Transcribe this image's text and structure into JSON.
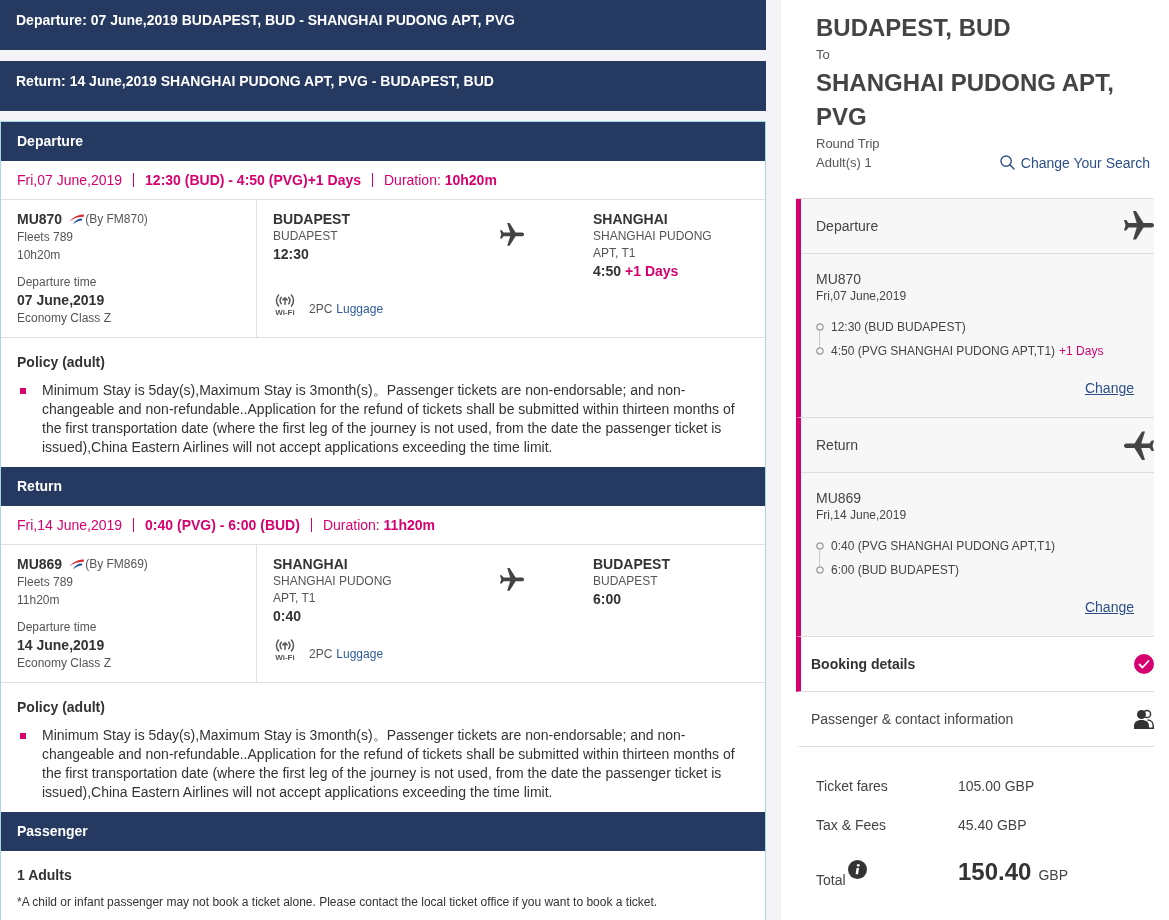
{
  "banners": [
    {
      "text": "Departure: 07 June,2019 BUDAPEST, BUD - SHANGHAI PUDONG APT, PVG"
    },
    {
      "text": "Return: 14 June,2019 SHANGHAI PUDONG APT, PVG - BUDAPEST, BUD"
    }
  ],
  "segments": [
    {
      "heading": "Departure",
      "date": "Fri,07 June,2019",
      "times": "12:30 (BUD) - 4:50 (PVG)+1 Days",
      "duration": "Duration: **10h20m**",
      "flight": {
        "number": "MU870",
        "operator": "(By FM870)",
        "fleet": "Fleets 789",
        "flight_time": "10h20m",
        "departure_label": "Departure time",
        "departure_date": "07 June,2019",
        "cabin": "Economy Class Z"
      },
      "origin": {
        "city": "BUDAPEST",
        "airport": "BUDAPEST",
        "time": "12:30"
      },
      "destination": {
        "city": "SHANGHAI",
        "airport": "SHANGHAI PUDONG APT, T1",
        "time": "4:50",
        "day_offset": "+1 Days"
      },
      "wifi_label": "Wi-Fi",
      "baggage": "2PC",
      "baggage_link": "Luggage",
      "policy": {
        "title": "Policy (adult)",
        "items": [
          "Minimum Stay is 5day(s),Maximum Stay is 3month(s)。Passenger tickets are non-endorsable; and non-changeable and non-refundable..Application for the refund of tickets shall be submitted within thirteen months of the first transportation date (where the first leg of the journey is not used, from the date the passenger ticket is issued),China Eastern Airlines will not accept applications exceeding the time limit."
        ]
      }
    },
    {
      "heading": "Return",
      "date": "Fri,14 June,2019",
      "times": "0:40 (PVG) - 6:00 (BUD)",
      "duration": "Duration: **11h20m**",
      "flight": {
        "number": "MU869",
        "operator": "(By FM869)",
        "fleet": "Fleets 789",
        "flight_time": "11h20m",
        "departure_label": "Departure time",
        "departure_date": "14 June,2019",
        "cabin": "Economy Class Z"
      },
      "origin": {
        "city": "SHANGHAI",
        "airport": "SHANGHAI PUDONG APT, T1",
        "time": "0:40"
      },
      "destination": {
        "city": "BUDAPEST",
        "airport": "BUDAPEST",
        "time": "6:00"
      },
      "wifi_label": "Wi-Fi",
      "baggage": "2PC",
      "baggage_link": "Luggage",
      "policy": {
        "title": "Policy (adult)",
        "items": [
          "Minimum Stay is 5day(s),Maximum Stay is 3month(s)。Passenger tickets are non-endorsable; and non-changeable and non-refundable..Application for the refund of tickets shall be submitted within thirteen months of the first transportation date (where the first leg of the journey is not used, from the date the passenger ticket is issued),China Eastern Airlines will not accept applications exceeding the time limit."
        ]
      }
    }
  ],
  "passenger": {
    "heading": "Passenger",
    "count": "1 Adults",
    "note": "*A child or infant passenger may not book a ticket alone. Please contact the local ticket office if you want to book a ticket."
  },
  "summary": {
    "origin": "BUDAPEST, BUD",
    "connector": "To",
    "destination": "SHANGHAI PUDONG APT, PVG",
    "trip_type": "Round Trip",
    "travellers": "Adult(s) 1",
    "change_search": "Change Your Search",
    "steps": [
      {
        "kind": "outbound",
        "title": "Departure",
        "active": true,
        "flight": "MU870",
        "date": "Fri,07 June,2019",
        "stops": [
          {
            "text": "12:30 (BUD BUDAPEST)"
          },
          {
            "text": "4:50 (PVG SHANGHAI PUDONG APT,T1)",
            "day_offset": "+1 Days"
          }
        ],
        "change": "Change"
      },
      {
        "kind": "inbound",
        "title": "Return",
        "active": true,
        "flight": "MU869",
        "date": "Fri,14 June,2019",
        "stops": [
          {
            "text": "0:40 (PVG SHANGHAI PUDONG APT,T1)"
          },
          {
            "text": "6:00 (BUD BUDAPEST)"
          }
        ],
        "change": "Change"
      },
      {
        "kind": "completed",
        "title": "Booking details",
        "active": true
      },
      {
        "kind": "travellers",
        "title": "Passenger & contact information",
        "active": false
      }
    ],
    "fares": [
      {
        "label": "Ticket fares",
        "value": "105.00 GBP"
      },
      {
        "label": "Tax & Fees",
        "value": "45.40 GBP"
      }
    ],
    "total": {
      "label": "Total",
      "amount": "150.40",
      "currency": "GBP"
    }
  }
}
